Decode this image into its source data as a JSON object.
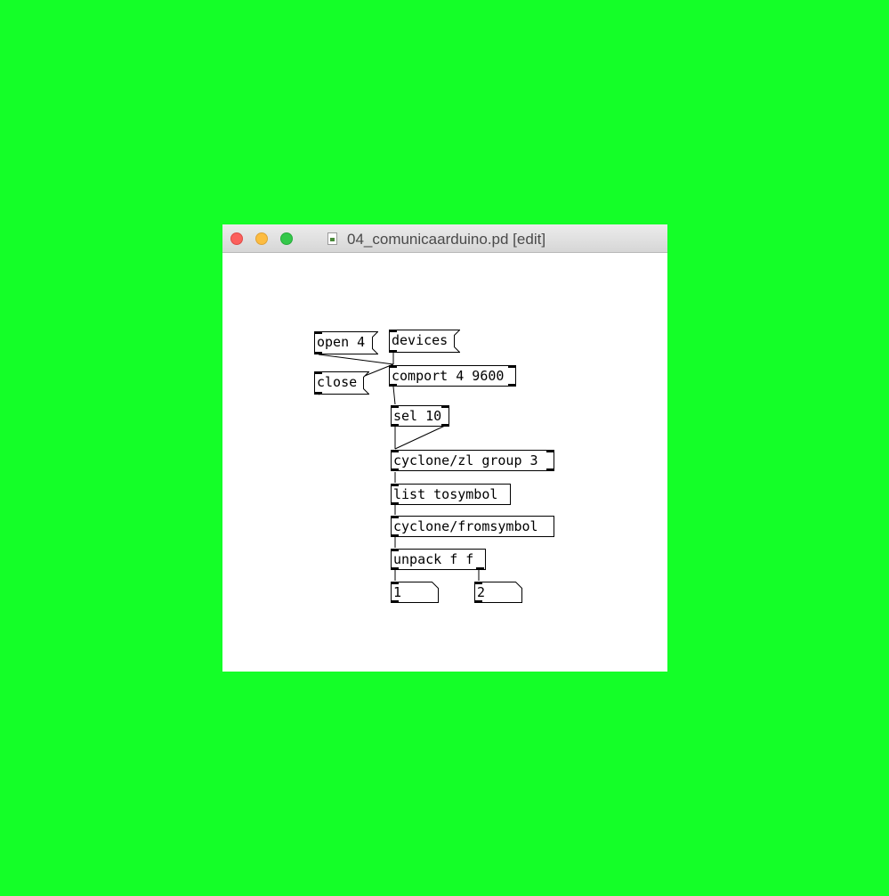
{
  "window": {
    "title": "04_comunicaarduino.pd [edit]"
  },
  "messages": {
    "open": "open 4",
    "close": "close",
    "devices": "devices"
  },
  "objects": {
    "comport": "comport 4 9600",
    "sel": "sel 10",
    "zl": "cyclone/zl group 3",
    "tosymbol": "list tosymbol",
    "fromsymbol": "cyclone/fromsymbol",
    "unpack": "unpack f f"
  },
  "numbers": {
    "n1": "1",
    "n2": "2"
  },
  "colors": {
    "background": "#14ff28",
    "canvas": "#ffffff",
    "ink": "#000000"
  }
}
